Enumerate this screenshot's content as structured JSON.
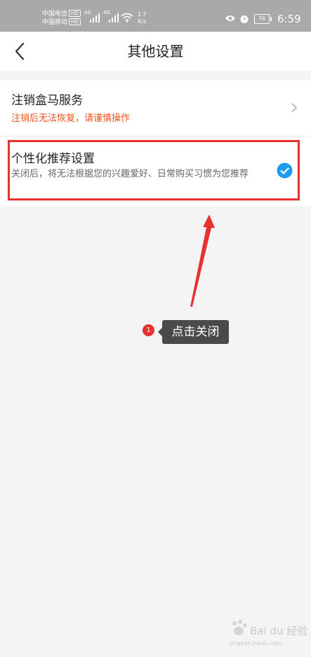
{
  "status_bar": {
    "carrier1": "中国电信",
    "carrier2": "中国移动",
    "hd": "HD",
    "net1": "4G",
    "net2": "4G",
    "speed_value": "1.7",
    "speed_unit": "K/s",
    "battery": "76",
    "time": "6:59"
  },
  "nav": {
    "title": "其他设置"
  },
  "settings": {
    "cancel_service": {
      "title": "注销盒马服务",
      "subtitle": "注销后无法恢复，请谨慎操作"
    },
    "personalized": {
      "title": "个性化推荐设置",
      "description": "关闭后，将无法根据您的兴趣爱好、日常购买习惯为您推荐",
      "checked": true
    }
  },
  "annotation": {
    "step": "1",
    "tooltip": "点击关闭"
  },
  "watermark": {
    "text": "Bai du 经验",
    "url": "jingyan.baidu.com"
  },
  "colors": {
    "accent_blue": "#1e9bf0",
    "warning_orange": "#f0541e",
    "annotation_red": "#e8322f"
  }
}
